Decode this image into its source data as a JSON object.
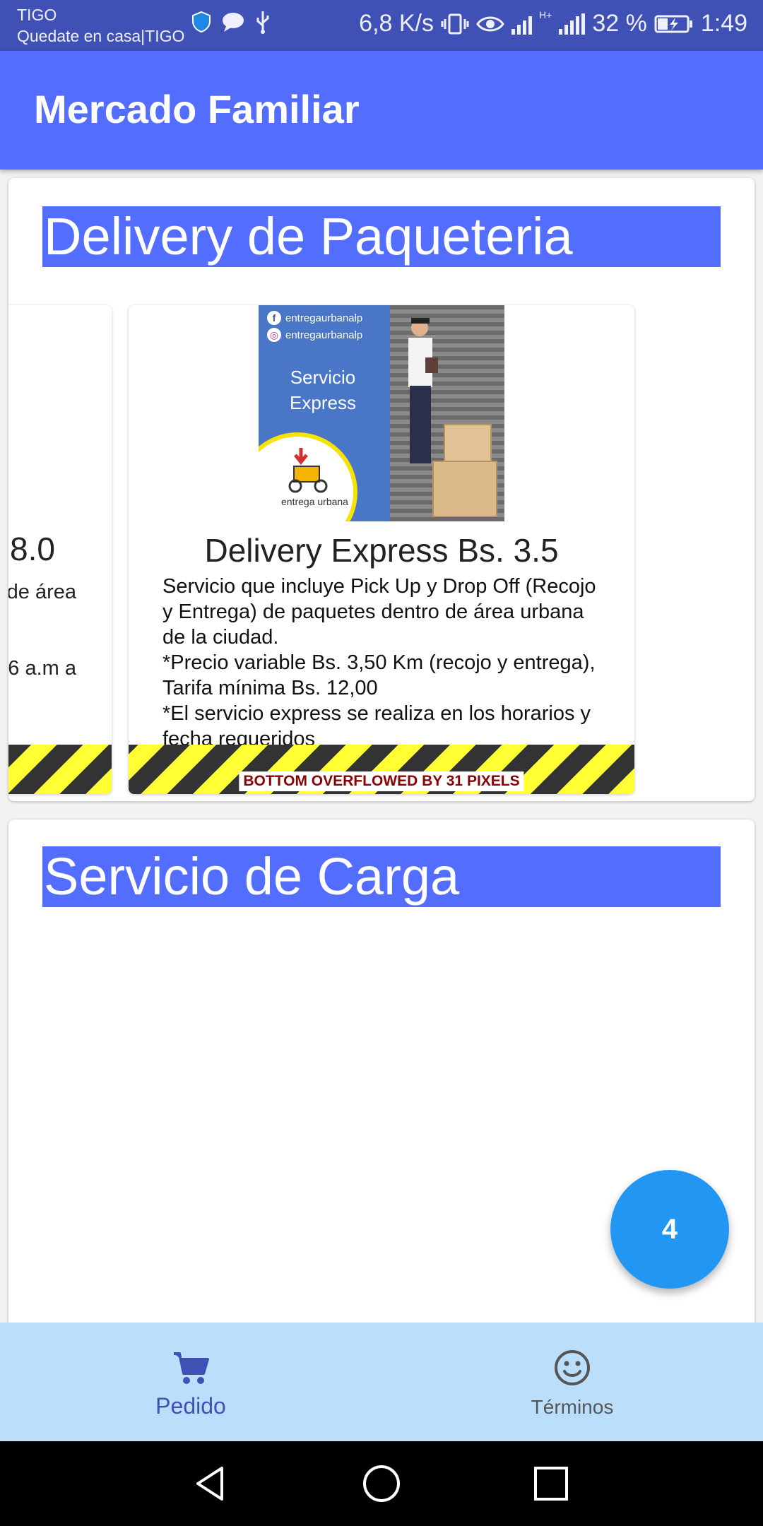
{
  "status_bar": {
    "carrier": "TIGO",
    "carrier_subtitle": "Quedate en casa|TIGO",
    "network_speed": "6,8 K/s",
    "battery": "32 %",
    "time": "1:49",
    "network_type": "H+"
  },
  "app_bar": {
    "title": "Mercado Familiar"
  },
  "sections": [
    {
      "title": "Delivery de Paqueteria",
      "products": [
        {
          "title_partial": "8.0",
          "desc_lines_partial": [
            "de área",
            "6 a.m a"
          ]
        },
        {
          "title": "Delivery Express Bs. 3.5",
          "description": "Servicio que incluye Pick Up y Drop Off (Recojo y Entrega) de paquetes dentro de área urbana de la ciudad.\n*Precio variable Bs. 3,50 Km (recojo y entrega), Tarifa mínima Bs. 12,00\n*El servicio express se realiza en los horarios y fecha requeridos",
          "image": {
            "social_handle_facebook": "entregaurbanalp",
            "social_handle_instagram": "entregaurbanalp",
            "service_text": "Servicio Express",
            "brand_text": "entrega urbana"
          },
          "overflow_warning": "BOTTOM OVERFLOWED BY 31 PIXELS"
        }
      ]
    },
    {
      "title": "Servicio de Carga",
      "products": []
    }
  ],
  "fab": {
    "label": "4",
    "color": "#2196f3"
  },
  "bottom_nav": {
    "items": [
      {
        "label": "Pedido",
        "icon": "cart-icon",
        "active": true
      },
      {
        "label": "Términos",
        "icon": "smiley-icon",
        "active": false
      }
    ]
  },
  "colors": {
    "primary": "#536dfe",
    "status_bar": "#3f51b5",
    "bottom_nav_bg": "#bbdefb"
  }
}
